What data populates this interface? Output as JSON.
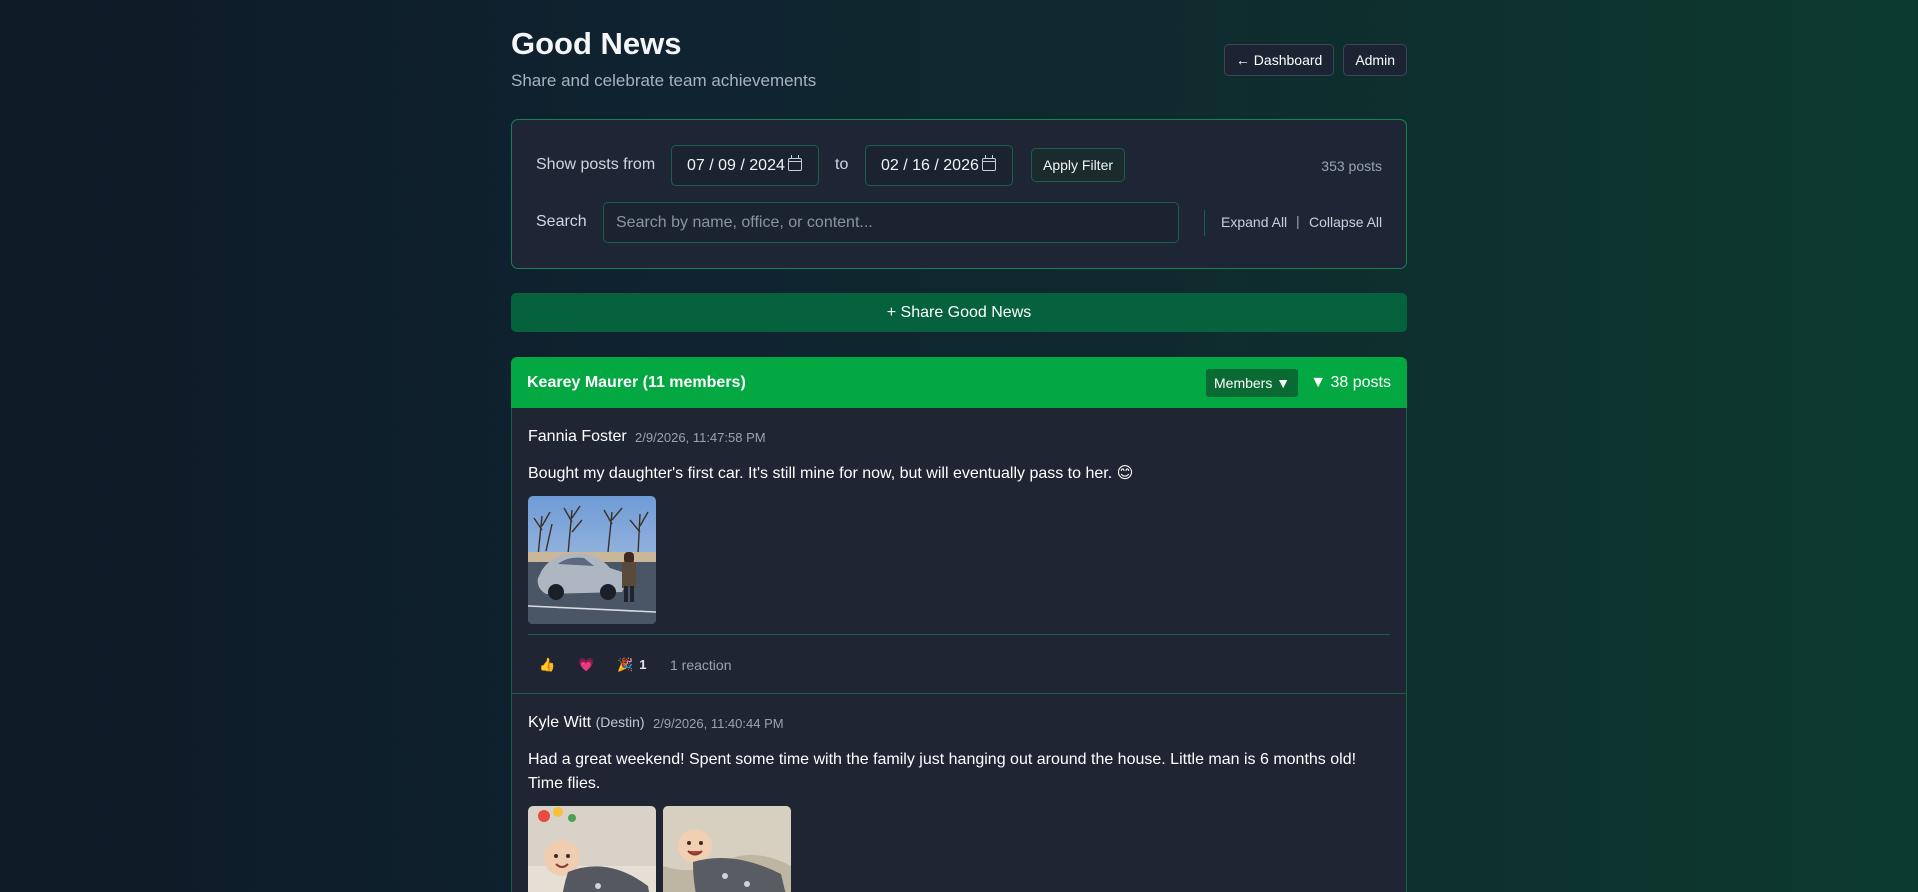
{
  "header": {
    "title": "Good News",
    "subtitle": "Share and celebrate team achievements",
    "dashboard_label": "← Dashboard",
    "admin_label": "Admin"
  },
  "filter": {
    "from_label": "Show posts from",
    "from_date": "07 / 09 / 2024",
    "to_label": "to",
    "to_date": "02 / 16 / 2026",
    "apply_label": "Apply Filter",
    "post_count": "353 posts",
    "search_label": "Search",
    "search_placeholder": "Search by name, office, or content...",
    "expand_label": "Expand All",
    "separator": "|",
    "collapse_label": "Collapse All"
  },
  "share_label": "+ Share Good News",
  "group": {
    "title": "Kearey Maurer (11 members)",
    "members_label": "Members ▼",
    "posts_label": "▼ 38 posts"
  },
  "posts": [
    {
      "author": "Fannia Foster",
      "office": "",
      "timestamp": "2/9/2026, 11:47:58 PM",
      "text": "Bought my daughter's first car. It's still mine for now, but will eventually pass to her.  😊",
      "reactions": [
        {
          "icon": "👍",
          "name": "thumbs-up-icon",
          "count": ""
        },
        {
          "icon": "💗",
          "name": "heart-icon",
          "count": ""
        },
        {
          "icon": "🎉",
          "name": "party-icon",
          "count": "1"
        }
      ],
      "reaction_total": "1 reaction"
    },
    {
      "author": "Kyle Witt",
      "office": "(Destin)",
      "timestamp": "2/9/2026, 11:40:44 PM",
      "text": "Had a great weekend! Spent some time with the family just hanging out around the house. Little man is 6 months old! Time flies."
    }
  ],
  "colors": {
    "accent_green": "#03a843",
    "share_green": "#05623c",
    "border_green": "#17614a",
    "panel_bg": "#1e2635"
  }
}
